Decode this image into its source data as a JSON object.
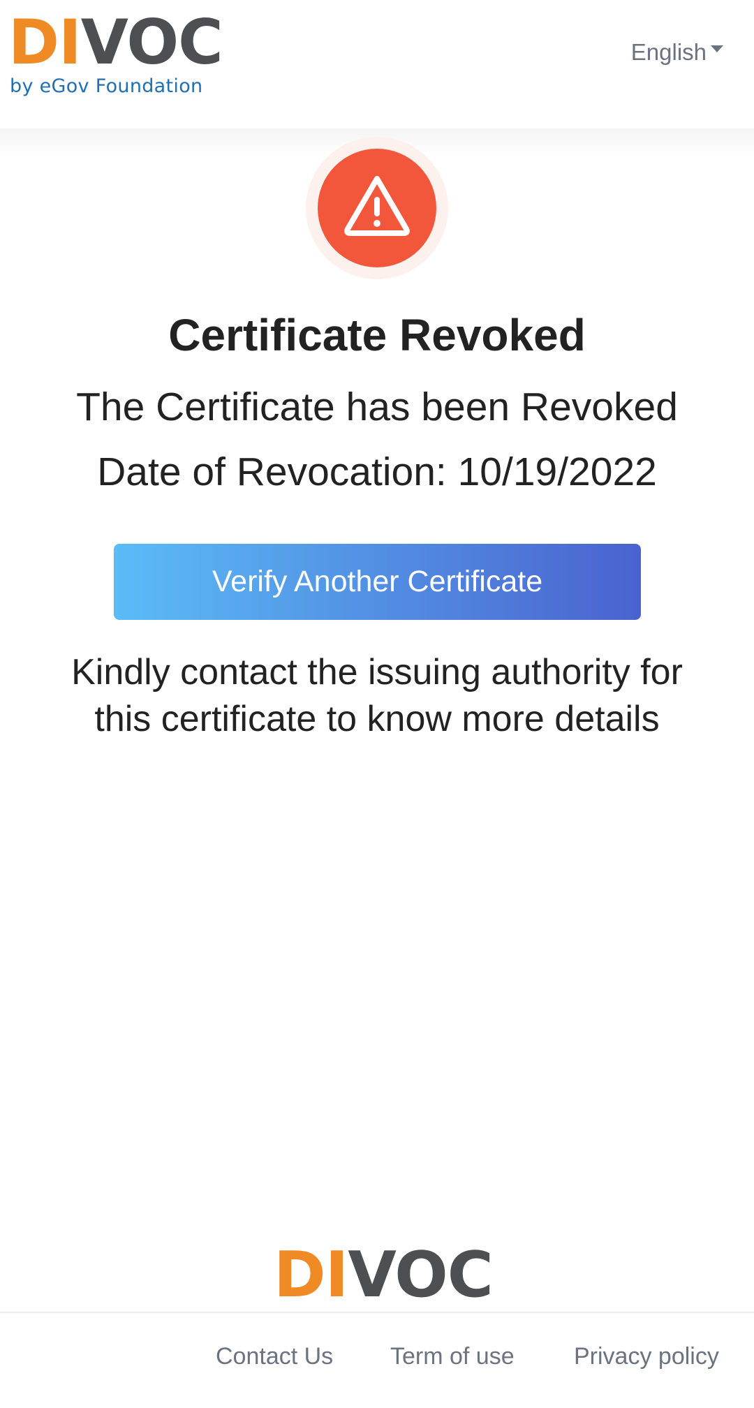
{
  "header": {
    "logo": {
      "wordmark_part1": "DI",
      "wordmark_part2": "VOC",
      "tagline": "by eGov Foundation"
    },
    "language": {
      "selected": "English",
      "icon": "chevron-down-icon"
    }
  },
  "status": {
    "icon": "warning-triangle-icon",
    "title": "Certificate Revoked",
    "message": "The Certificate has been Revoked",
    "revocation_label": "Date of Revocation: 10/19/2022"
  },
  "actions": {
    "verify_another_label": "Verify Another Certificate"
  },
  "note": {
    "text": "Kindly contact the issuing authority for this certificate to know more details"
  },
  "footer": {
    "logo": {
      "wordmark_part1": "DI",
      "wordmark_part2": "VOC"
    },
    "links": [
      {
        "label": "Contact Us"
      },
      {
        "label": "Term of use"
      },
      {
        "label": "Privacy policy"
      }
    ]
  },
  "colors": {
    "alert": "#f2573b",
    "button_gradient_start": "#5bbcf7",
    "button_gradient_end": "#4a62cf",
    "logo_orange": "#f08a24",
    "logo_grey": "#4d4f53",
    "tagline_blue": "#1f6fb5"
  }
}
